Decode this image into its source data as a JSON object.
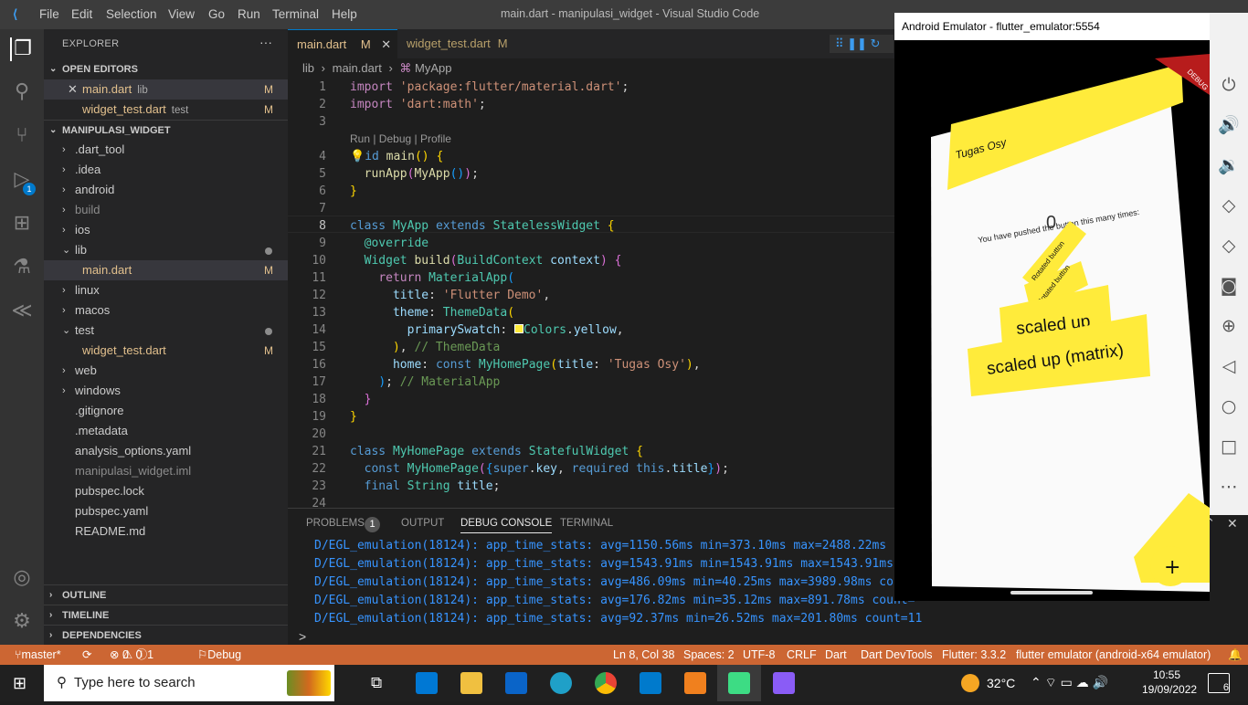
{
  "window": {
    "title": "main.dart - manipulasi_widget - Visual Studio Code",
    "menu": [
      "File",
      "Edit",
      "Selection",
      "View",
      "Go",
      "Run",
      "Terminal",
      "Help"
    ]
  },
  "activity": {
    "debug_badge": "1"
  },
  "explorer": {
    "header": "EXPLORER",
    "dots": "···",
    "open_editors_title": "OPEN EDITORS",
    "open_editors": [
      {
        "name": "main.dart",
        "dir": "lib",
        "status": "M",
        "close": "✕"
      },
      {
        "name": "widget_test.dart",
        "dir": "test",
        "status": "M"
      }
    ],
    "project_title": "MANIPULASI_WIDGET",
    "tree": [
      {
        "name": ".dart_tool",
        "type": "folder"
      },
      {
        "name": ".idea",
        "type": "folder"
      },
      {
        "name": "android",
        "type": "folder"
      },
      {
        "name": "build",
        "type": "folder"
      },
      {
        "name": "ios",
        "type": "folder"
      },
      {
        "name": "lib",
        "type": "folder-open"
      },
      {
        "name": "main.dart",
        "type": "file",
        "status": "M"
      },
      {
        "name": "linux",
        "type": "folder"
      },
      {
        "name": "macos",
        "type": "folder"
      },
      {
        "name": "test",
        "type": "folder-open"
      },
      {
        "name": "widget_test.dart",
        "type": "file",
        "status": "M"
      },
      {
        "name": "web",
        "type": "folder"
      },
      {
        "name": "windows",
        "type": "folder"
      },
      {
        "name": ".gitignore",
        "type": "file"
      },
      {
        "name": ".metadata",
        "type": "file"
      },
      {
        "name": "analysis_options.yaml",
        "type": "file"
      },
      {
        "name": "manipulasi_widget.iml",
        "type": "file"
      },
      {
        "name": "pubspec.lock",
        "type": "file"
      },
      {
        "name": "pubspec.yaml",
        "type": "file"
      },
      {
        "name": "README.md",
        "type": "file"
      }
    ],
    "outline": "OUTLINE",
    "timeline": "TIMELINE",
    "dependencies": "DEPENDENCIES"
  },
  "tabs": [
    {
      "name": "main.dart",
      "status": "M",
      "close": "✕"
    },
    {
      "name": "widget_test.dart",
      "status": "M"
    }
  ],
  "breadcrumb": {
    "a": "lib",
    "b": "main.dart",
    "c": "MyApp",
    "sep": "›"
  },
  "codelens": "Run | Debug | Profile",
  "line_numbers": [
    "1",
    "2",
    "3",
    "4",
    "5",
    "6",
    "7",
    "8",
    "9",
    "10",
    "11",
    "12",
    "13",
    "14",
    "15",
    "16",
    "17",
    "18",
    "19",
    "20",
    "21",
    "22",
    "23",
    "24"
  ],
  "panel": {
    "tabs": [
      "PROBLEMS",
      "OUTPUT",
      "DEBUG CONSOLE",
      "TERMINAL"
    ],
    "problems_count": "1",
    "console": [
      "D/EGL_emulation(18124): app_time_stats: avg=1150.56ms min=373.10ms max=2488.22ms co",
      "D/EGL_emulation(18124): app_time_stats: avg=1543.91ms min=1543.91ms max=1543.91ms c",
      "D/EGL_emulation(18124): app_time_stats: avg=486.09ms min=40.25ms max=3989.98ms coun",
      "D/EGL_emulation(18124): app_time_stats: avg=176.82ms min=35.12ms max=891.78ms count=",
      "D/EGL_emulation(18124): app_time_stats: avg=92.37ms min=26.52ms max=201.80ms count=11"
    ],
    "prompt": ">"
  },
  "status": {
    "branch": "master*",
    "errors": "0",
    "warnings": "0",
    "infos": "1",
    "debug": "Debug my code",
    "position": "Ln 8, Col 38",
    "spaces": "Spaces: 2",
    "encoding": "UTF-8",
    "eol": "CRLF",
    "lang": "Dart",
    "devtools": "Dart DevTools",
    "flutter": "Flutter: 3.3.2",
    "device": "flutter emulator (android-x64 emulator)"
  },
  "emulator": {
    "title": "Android Emulator - flutter_emulator:5554",
    "app_title": "Tugas Osy",
    "pushed": "You have pushed the button this many times:",
    "count": "0",
    "rotated1": "Rotated button",
    "rotated2": "Rotated button",
    "scaled": "scaled up",
    "scaled_matrix": "scaled up (matrix)",
    "debug": "DEBUG",
    "fab": "+"
  },
  "taskbar": {
    "search_placeholder": "Type here to search",
    "weather": "32°C",
    "time": "10:55",
    "date": "19/09/2022",
    "notif": "6"
  },
  "colors": {
    "accent": "#007acc",
    "status": "#cc6633",
    "yellow": "#ffeb3b"
  }
}
